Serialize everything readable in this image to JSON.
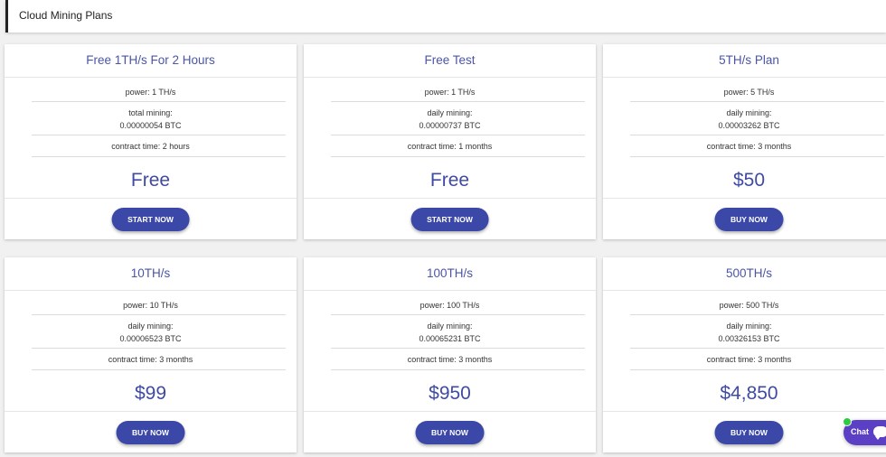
{
  "header": {
    "title": "Cloud Mining Plans"
  },
  "plans": [
    {
      "title": "Free 1TH/s For 2 Hours",
      "power": "power: 1 TH/s",
      "mining_label": "total mining:",
      "mining_value": "0.00000054 BTC",
      "contract": "contract time: 2 hours",
      "price": "Free",
      "button": "START NOW"
    },
    {
      "title": "Free Test",
      "power": "power: 1 TH/s",
      "mining_label": "daily mining:",
      "mining_value": "0.00000737 BTC",
      "contract": "contract time: 1 months",
      "price": "Free",
      "button": "START NOW"
    },
    {
      "title": "5TH/s Plan",
      "power": "power: 5 TH/s",
      "mining_label": "daily mining:",
      "mining_value": "0.00003262 BTC",
      "contract": "contract time: 3 months",
      "price": "$50",
      "button": "BUY NOW"
    },
    {
      "title": "10TH/s",
      "power": "power: 10 TH/s",
      "mining_label": "daily mining:",
      "mining_value": "0.00006523 BTC",
      "contract": "contract time: 3 months",
      "price": "$99",
      "button": "BUY NOW"
    },
    {
      "title": "100TH/s",
      "power": "power: 100 TH/s",
      "mining_label": "daily mining:",
      "mining_value": "0.00065231 BTC",
      "contract": "contract time: 3 months",
      "price": "$950",
      "button": "BUY NOW"
    },
    {
      "title": "500TH/s",
      "power": "power: 500 TH/s",
      "mining_label": "daily mining:",
      "mining_value": "0.00326153 BTC",
      "contract": "contract time: 3 months",
      "price": "$4,850",
      "button": "BUY NOW"
    }
  ],
  "chat": {
    "label": "Chat",
    "icon": "chat-bubble-icon",
    "status_color": "#2ecc40"
  },
  "colors": {
    "accent": "#3b48a8",
    "title_text": "#4a55a8",
    "chat_bg": "#5b3fc4"
  }
}
